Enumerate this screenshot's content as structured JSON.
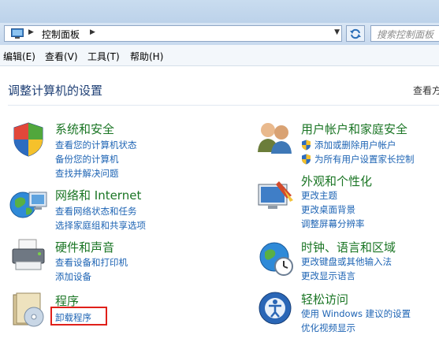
{
  "address": {
    "crumb": "控制面板",
    "search_placeholder": "搜索控制面板"
  },
  "menu": {
    "edit": "编辑(E)",
    "view": "查看(V)",
    "tools": "工具(T)",
    "help": "帮助(H)"
  },
  "content": {
    "heading": "调整计算机的设置",
    "view_by": "查看方"
  },
  "categories": {
    "system_security": {
      "title": "系统和安全",
      "links": [
        "查看您的计算机状态",
        "备份您的计算机",
        "查找并解决问题"
      ]
    },
    "network": {
      "title": "网络和 Internet",
      "links": [
        "查看网络状态和任务",
        "选择家庭组和共享选项"
      ]
    },
    "hardware": {
      "title": "硬件和声音",
      "links": [
        "查看设备和打印机",
        "添加设备"
      ]
    },
    "programs": {
      "title": "程序",
      "links": [
        "卸载程序"
      ]
    },
    "user_accounts": {
      "title": "用户帐户和家庭安全",
      "links": [
        "添加或删除用户帐户",
        "为所有用户设置家长控制"
      ]
    },
    "appearance": {
      "title": "外观和个性化",
      "links": [
        "更改主题",
        "更改桌面背景",
        "调整屏幕分辨率"
      ]
    },
    "clock": {
      "title": "时钟、语言和区域",
      "links": [
        "更改键盘或其他输入法",
        "更改显示语言"
      ]
    },
    "ease": {
      "title": "轻松访问",
      "links": [
        "使用 Windows 建议的设置",
        "优化视频显示"
      ]
    }
  },
  "colors": {
    "category_title": "#1a7524",
    "link": "#1e64b4",
    "highlight_box": "#e0201a"
  }
}
